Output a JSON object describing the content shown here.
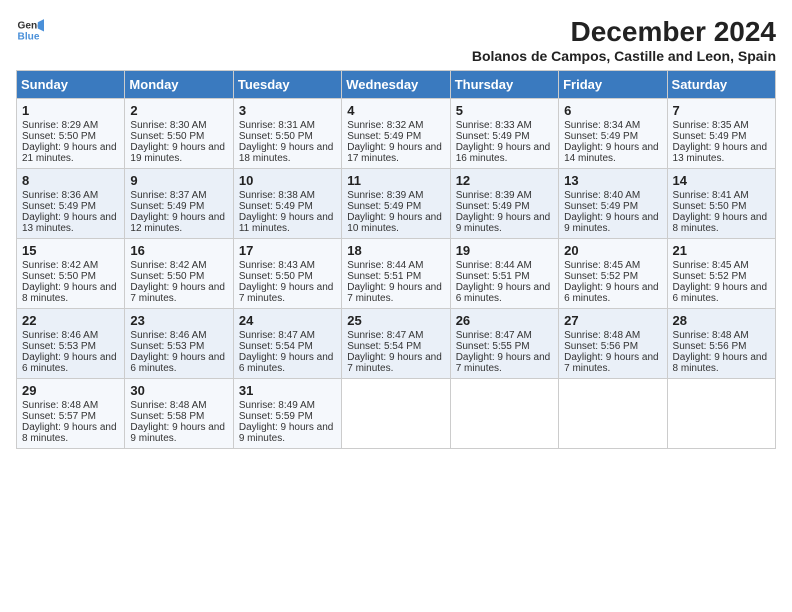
{
  "header": {
    "logo_line1": "General",
    "logo_line2": "Blue",
    "title": "December 2024",
    "subtitle": "Bolanos de Campos, Castille and Leon, Spain"
  },
  "weekdays": [
    "Sunday",
    "Monday",
    "Tuesday",
    "Wednesday",
    "Thursday",
    "Friday",
    "Saturday"
  ],
  "weeks": [
    [
      {
        "day": "1",
        "sunrise": "Sunrise: 8:29 AM",
        "sunset": "Sunset: 5:50 PM",
        "daylight": "Daylight: 9 hours and 21 minutes."
      },
      {
        "day": "2",
        "sunrise": "Sunrise: 8:30 AM",
        "sunset": "Sunset: 5:50 PM",
        "daylight": "Daylight: 9 hours and 19 minutes."
      },
      {
        "day": "3",
        "sunrise": "Sunrise: 8:31 AM",
        "sunset": "Sunset: 5:50 PM",
        "daylight": "Daylight: 9 hours and 18 minutes."
      },
      {
        "day": "4",
        "sunrise": "Sunrise: 8:32 AM",
        "sunset": "Sunset: 5:49 PM",
        "daylight": "Daylight: 9 hours and 17 minutes."
      },
      {
        "day": "5",
        "sunrise": "Sunrise: 8:33 AM",
        "sunset": "Sunset: 5:49 PM",
        "daylight": "Daylight: 9 hours and 16 minutes."
      },
      {
        "day": "6",
        "sunrise": "Sunrise: 8:34 AM",
        "sunset": "Sunset: 5:49 PM",
        "daylight": "Daylight: 9 hours and 14 minutes."
      },
      {
        "day": "7",
        "sunrise": "Sunrise: 8:35 AM",
        "sunset": "Sunset: 5:49 PM",
        "daylight": "Daylight: 9 hours and 13 minutes."
      }
    ],
    [
      {
        "day": "8",
        "sunrise": "Sunrise: 8:36 AM",
        "sunset": "Sunset: 5:49 PM",
        "daylight": "Daylight: 9 hours and 13 minutes."
      },
      {
        "day": "9",
        "sunrise": "Sunrise: 8:37 AM",
        "sunset": "Sunset: 5:49 PM",
        "daylight": "Daylight: 9 hours and 12 minutes."
      },
      {
        "day": "10",
        "sunrise": "Sunrise: 8:38 AM",
        "sunset": "Sunset: 5:49 PM",
        "daylight": "Daylight: 9 hours and 11 minutes."
      },
      {
        "day": "11",
        "sunrise": "Sunrise: 8:39 AM",
        "sunset": "Sunset: 5:49 PM",
        "daylight": "Daylight: 9 hours and 10 minutes."
      },
      {
        "day": "12",
        "sunrise": "Sunrise: 8:39 AM",
        "sunset": "Sunset: 5:49 PM",
        "daylight": "Daylight: 9 hours and 9 minutes."
      },
      {
        "day": "13",
        "sunrise": "Sunrise: 8:40 AM",
        "sunset": "Sunset: 5:49 PM",
        "daylight": "Daylight: 9 hours and 9 minutes."
      },
      {
        "day": "14",
        "sunrise": "Sunrise: 8:41 AM",
        "sunset": "Sunset: 5:50 PM",
        "daylight": "Daylight: 9 hours and 8 minutes."
      }
    ],
    [
      {
        "day": "15",
        "sunrise": "Sunrise: 8:42 AM",
        "sunset": "Sunset: 5:50 PM",
        "daylight": "Daylight: 9 hours and 8 minutes."
      },
      {
        "day": "16",
        "sunrise": "Sunrise: 8:42 AM",
        "sunset": "Sunset: 5:50 PM",
        "daylight": "Daylight: 9 hours and 7 minutes."
      },
      {
        "day": "17",
        "sunrise": "Sunrise: 8:43 AM",
        "sunset": "Sunset: 5:50 PM",
        "daylight": "Daylight: 9 hours and 7 minutes."
      },
      {
        "day": "18",
        "sunrise": "Sunrise: 8:44 AM",
        "sunset": "Sunset: 5:51 PM",
        "daylight": "Daylight: 9 hours and 7 minutes."
      },
      {
        "day": "19",
        "sunrise": "Sunrise: 8:44 AM",
        "sunset": "Sunset: 5:51 PM",
        "daylight": "Daylight: 9 hours and 6 minutes."
      },
      {
        "day": "20",
        "sunrise": "Sunrise: 8:45 AM",
        "sunset": "Sunset: 5:52 PM",
        "daylight": "Daylight: 9 hours and 6 minutes."
      },
      {
        "day": "21",
        "sunrise": "Sunrise: 8:45 AM",
        "sunset": "Sunset: 5:52 PM",
        "daylight": "Daylight: 9 hours and 6 minutes."
      }
    ],
    [
      {
        "day": "22",
        "sunrise": "Sunrise: 8:46 AM",
        "sunset": "Sunset: 5:53 PM",
        "daylight": "Daylight: 9 hours and 6 minutes."
      },
      {
        "day": "23",
        "sunrise": "Sunrise: 8:46 AM",
        "sunset": "Sunset: 5:53 PM",
        "daylight": "Daylight: 9 hours and 6 minutes."
      },
      {
        "day": "24",
        "sunrise": "Sunrise: 8:47 AM",
        "sunset": "Sunset: 5:54 PM",
        "daylight": "Daylight: 9 hours and 6 minutes."
      },
      {
        "day": "25",
        "sunrise": "Sunrise: 8:47 AM",
        "sunset": "Sunset: 5:54 PM",
        "daylight": "Daylight: 9 hours and 7 minutes."
      },
      {
        "day": "26",
        "sunrise": "Sunrise: 8:47 AM",
        "sunset": "Sunset: 5:55 PM",
        "daylight": "Daylight: 9 hours and 7 minutes."
      },
      {
        "day": "27",
        "sunrise": "Sunrise: 8:48 AM",
        "sunset": "Sunset: 5:56 PM",
        "daylight": "Daylight: 9 hours and 7 minutes."
      },
      {
        "day": "28",
        "sunrise": "Sunrise: 8:48 AM",
        "sunset": "Sunset: 5:56 PM",
        "daylight": "Daylight: 9 hours and 8 minutes."
      }
    ],
    [
      {
        "day": "29",
        "sunrise": "Sunrise: 8:48 AM",
        "sunset": "Sunset: 5:57 PM",
        "daylight": "Daylight: 9 hours and 8 minutes."
      },
      {
        "day": "30",
        "sunrise": "Sunrise: 8:48 AM",
        "sunset": "Sunset: 5:58 PM",
        "daylight": "Daylight: 9 hours and 9 minutes."
      },
      {
        "day": "31",
        "sunrise": "Sunrise: 8:49 AM",
        "sunset": "Sunset: 5:59 PM",
        "daylight": "Daylight: 9 hours and 9 minutes."
      },
      null,
      null,
      null,
      null
    ]
  ]
}
